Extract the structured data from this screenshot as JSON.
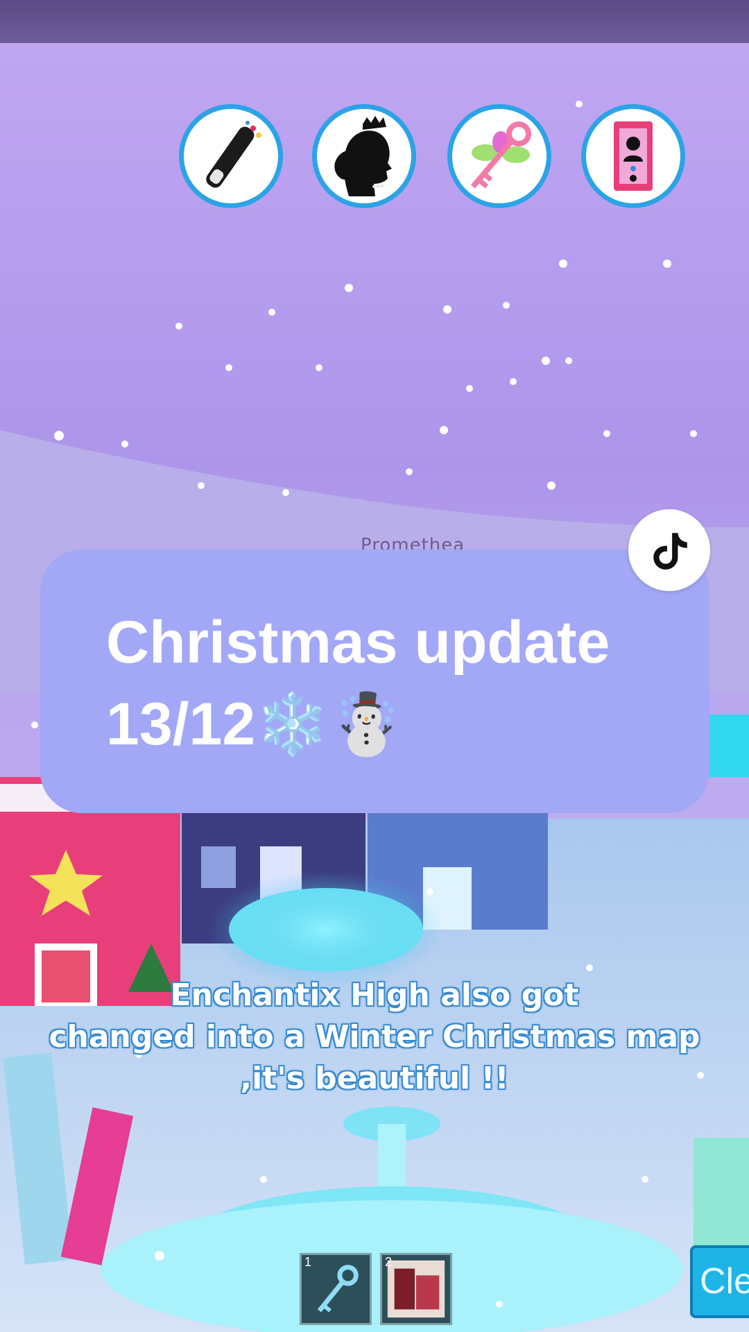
{
  "overlay": {
    "title_line1": "Christmas update",
    "title_line2": "13/12❄️☃️",
    "creator_name": "Promethea",
    "caption_lines": [
      "Enchantix High also got",
      "changed into a Winter Christmas map",
      ",it's beautiful !!"
    ]
  },
  "hud": {
    "buttons": [
      {
        "name": "wand-icon"
      },
      {
        "name": "princess-avatar-icon"
      },
      {
        "name": "fairy-key-icon"
      },
      {
        "name": "phone-icon"
      }
    ]
  },
  "hotbar": {
    "slots": [
      {
        "number": "1",
        "item": "key"
      },
      {
        "number": "2",
        "item": "photo"
      }
    ],
    "clear_label": "Cle"
  },
  "colors": {
    "card": "#a2a8f6",
    "hud_ring": "#2ca3e6",
    "caption_outline": "#3b8fd6",
    "sky_top": "#b89bec"
  }
}
